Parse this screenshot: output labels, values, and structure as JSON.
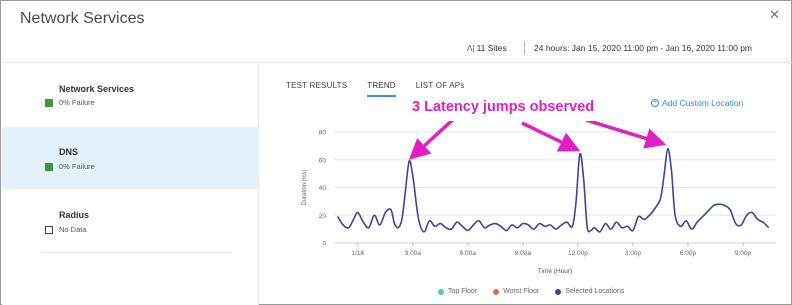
{
  "window": {
    "title": "Network Services",
    "close_icon": "close-icon"
  },
  "header": {
    "sites": "11 Sites",
    "time_range": "24 hours: Jan 15, 2020 11:00 pm - Jan 16, 2020 11:00 pm"
  },
  "sidebar": {
    "items": [
      {
        "label": "Network Services",
        "status": "0% Failure",
        "status_color": "#3f9c35",
        "active": false
      },
      {
        "label": "DNS",
        "status": "0% Failure",
        "status_color": "#3f9c35",
        "active": true
      },
      {
        "label": "Radius",
        "status": "No Data",
        "status_color": "",
        "active": false
      }
    ]
  },
  "tabs": [
    {
      "label": "TEST RESULTS",
      "active": false
    },
    {
      "label": "TREND",
      "active": true
    },
    {
      "label": "LIST OF APs",
      "active": false
    }
  ],
  "add_location": "Add Custom Location",
  "annotation": "3 Latency jumps observed",
  "colors": {
    "accent": "#2a8fd8",
    "annotation": "#e020c2",
    "series": "#3d4597",
    "success": "#3f9c35"
  },
  "chart_data": {
    "type": "line",
    "xlabel": "Time (Hour)",
    "ylabel": "Duration (ms)",
    "ylim": [
      0,
      80
    ],
    "y_ticks": [
      "80",
      "60",
      "40",
      "20",
      "0"
    ],
    "x_ticks": [
      {
        "label": "1/16",
        "x": 1
      },
      {
        "label": "3:00a",
        "x": 4
      },
      {
        "label": "6:00a",
        "x": 7
      },
      {
        "label": "9:00a",
        "x": 10
      },
      {
        "label": "12:00p",
        "x": 13
      },
      {
        "label": "3:00p",
        "x": 16
      },
      {
        "label": "6:00p",
        "x": 19
      },
      {
        "label": "9:00p",
        "x": 22
      }
    ],
    "xlim": [
      -0.3,
      23.8
    ],
    "grid": true,
    "legend_position": "bottom",
    "legend": [
      {
        "name": "Top Floor",
        "color": "#4fc6c9"
      },
      {
        "name": "Worst Floor",
        "color": "#e56b3e"
      },
      {
        "name": "Selected Locations",
        "color": "#3d4597"
      }
    ],
    "series": [
      {
        "name": "Selected Locations",
        "color": "#3d4597",
        "x": [
          -0.1,
          0.2,
          0.5,
          0.8,
          1.0,
          1.3,
          1.6,
          1.9,
          2.2,
          2.5,
          2.8,
          3.0,
          3.2,
          3.4,
          3.6,
          3.8,
          4.0,
          4.3,
          4.6,
          4.9,
          5.2,
          5.5,
          5.8,
          6.1,
          6.4,
          6.7,
          7.0,
          7.3,
          7.6,
          7.9,
          8.2,
          8.5,
          8.8,
          9.1,
          9.4,
          9.7,
          10.0,
          10.3,
          10.6,
          10.9,
          11.2,
          11.5,
          11.8,
          12.1,
          12.4,
          12.7,
          12.9,
          13.1,
          13.3,
          13.5,
          13.7,
          13.9,
          14.2,
          14.5,
          14.8,
          15.1,
          15.4,
          15.7,
          16.0,
          16.3,
          16.6,
          16.9,
          17.2,
          17.5,
          17.7,
          17.9,
          18.1,
          18.3,
          18.6,
          18.9,
          19.2,
          19.5,
          19.8,
          20.1,
          20.4,
          20.7,
          21.0,
          21.3,
          21.6,
          21.9,
          22.2,
          22.5,
          22.8,
          23.1,
          23.4
        ],
        "y": [
          19,
          13,
          11,
          18,
          22,
          15,
          11,
          20,
          13,
          22,
          24,
          14,
          11,
          17,
          38,
          59,
          48,
          18,
          8,
          16,
          12,
          14,
          11,
          10,
          15,
          12,
          9,
          13,
          16,
          11,
          13,
          14,
          12,
          9,
          13,
          11,
          14,
          13,
          10,
          14,
          12,
          13,
          10,
          13,
          15,
          12,
          30,
          64,
          48,
          12,
          9,
          11,
          8,
          14,
          10,
          15,
          11,
          12,
          9,
          19,
          17,
          20,
          25,
          32,
          49,
          68,
          52,
          20,
          12,
          16,
          10,
          15,
          19,
          23,
          27,
          28,
          27,
          24,
          14,
          13,
          20,
          22,
          17,
          15,
          11
        ]
      }
    ]
  }
}
